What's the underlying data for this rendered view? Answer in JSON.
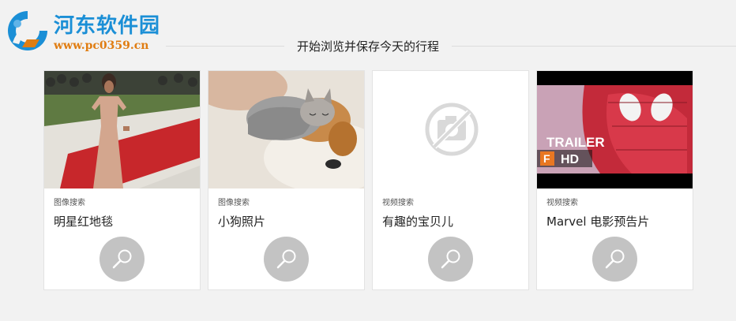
{
  "watermark": {
    "site_name": "河东软件园",
    "url": "www.pc0359.cn"
  },
  "header": {
    "title": "开始浏览并保存今天的行程"
  },
  "cards": [
    {
      "category": "图像搜索",
      "title": "明星红地毯",
      "thumbnail": "red-carpet-photo",
      "action_icon": "search-icon"
    },
    {
      "category": "图像搜索",
      "title": "小狗照片",
      "thumbnail": "puppy-kitten-photo",
      "action_icon": "search-icon"
    },
    {
      "category": "视频搜索",
      "title": "有趣的宝贝儿",
      "thumbnail": "no-image-placeholder-icon",
      "action_icon": "search-icon"
    },
    {
      "category": "视频搜索",
      "title": "Marvel 电影预告片",
      "thumbnail": "trailer-video-thumbnail",
      "action_icon": "search-icon",
      "thumb_text": {
        "trailer": "TRAILER",
        "hd": "HD",
        "badge": "F"
      }
    }
  ],
  "colors": {
    "background": "#f2f2f2",
    "card": "#ffffff",
    "search_button": "#c3c3c3",
    "watermark_title": "#1b8fd6",
    "watermark_url": "#e07d12"
  }
}
